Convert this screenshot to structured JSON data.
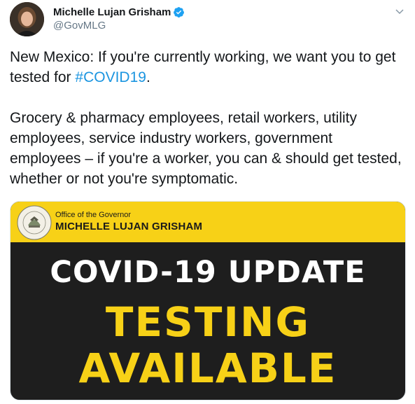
{
  "author": {
    "display_name": "Michelle Lujan Grisham",
    "handle": "@GovMLG",
    "verified": true
  },
  "tweet": {
    "paragraph_1_prefix": "New Mexico: If you're currently working, we want you to get tested for ",
    "hashtag": "#COVID19",
    "paragraph_1_suffix": ".",
    "paragraph_2": "Grocery & pharmacy employees, retail workers, utility employees, service industry workers, government employees – if you're a worker, you can & should get tested, whether or not you're symptomatic."
  },
  "media": {
    "banner_label": "Office of the Governor",
    "banner_name": "MICHELLE LUJAN GRISHAM",
    "headline_1": "COVID-19 UPDATE",
    "headline_2": "TESTING",
    "headline_3": "AVAILABLE",
    "seal_text": "GREAT SEAL OF THE STATE OF NEW MEXICO"
  },
  "colors": {
    "hashtag": "#1b95e0",
    "verified_badge": "#1da1f2",
    "banner_yellow": "#f7d117",
    "media_background": "#1e1e1e"
  },
  "icons": {
    "verified": "verified-badge-icon",
    "caret": "chevron-down-icon",
    "seal": "state-seal-icon"
  }
}
